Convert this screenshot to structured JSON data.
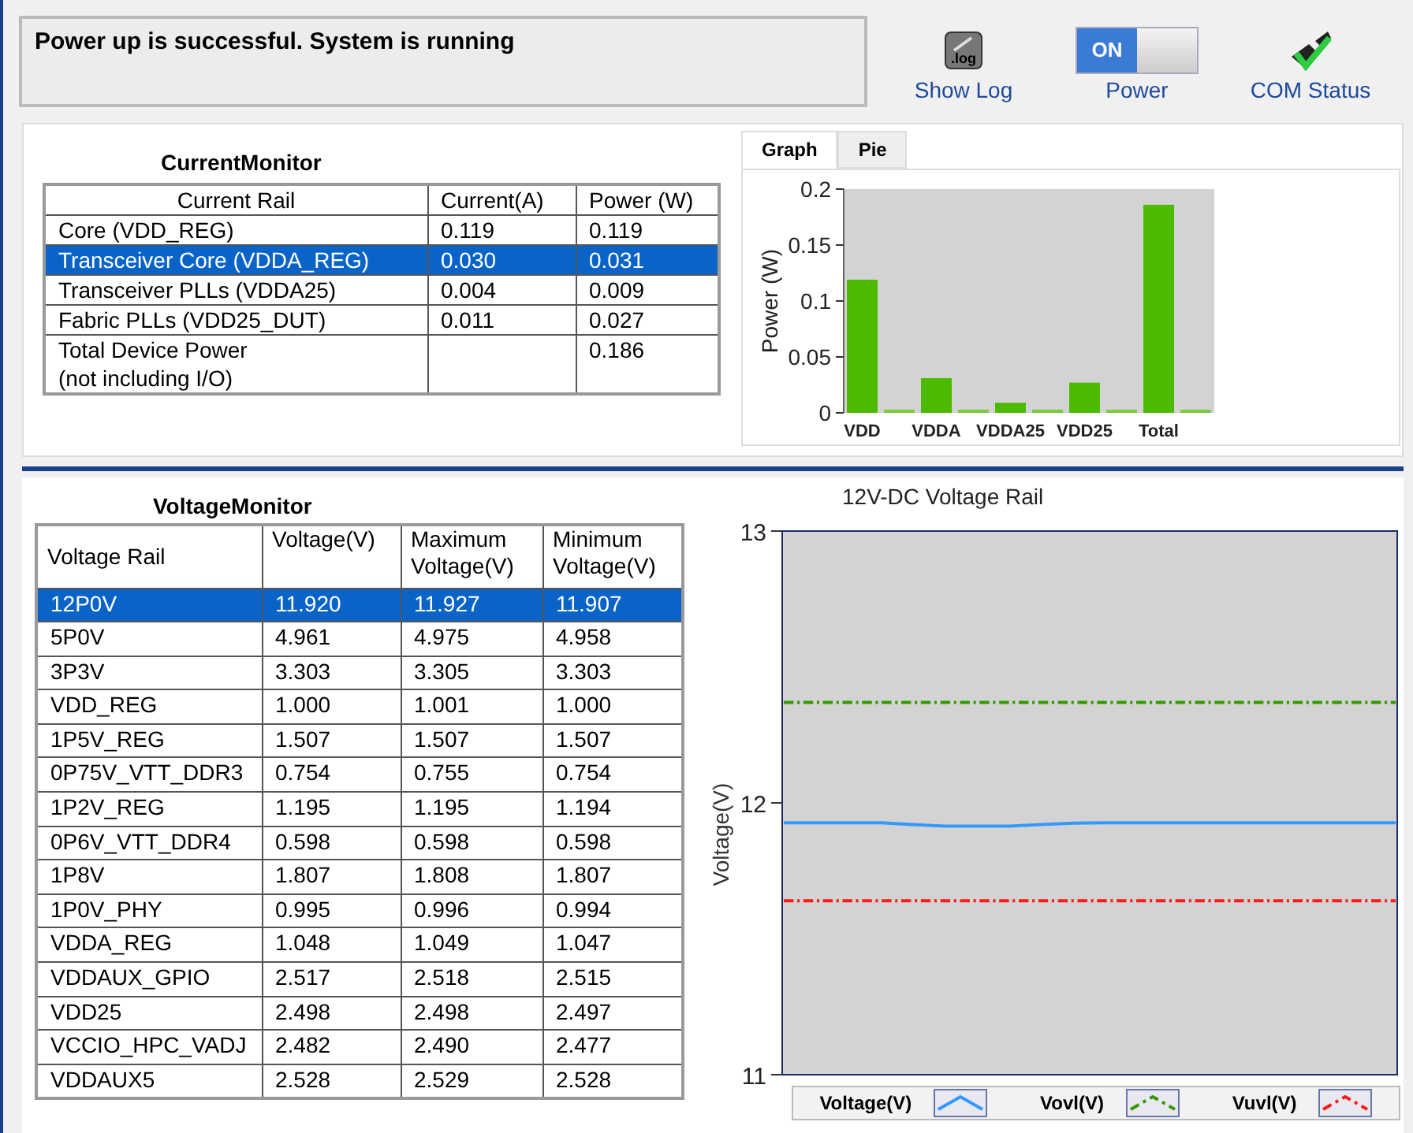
{
  "status_message": "Power up is successful. System is running",
  "toolbar": [
    {
      "kind": "log",
      "label": "Show Log",
      "badge": ".log"
    },
    {
      "kind": "switch",
      "label": "Power",
      "text": "ON",
      "on": true
    },
    {
      "kind": "com",
      "label": "COM Status"
    }
  ],
  "current_monitor": {
    "title": "CurrentMonitor",
    "columns": [
      "Current Rail",
      "Current(A)",
      "Power (W)"
    ],
    "rows": [
      {
        "cells": [
          "Core (VDD_REG)",
          "0.119",
          "0.119"
        ],
        "selected": false
      },
      {
        "cells": [
          "Transceiver Core (VDDA_REG)",
          "0.030",
          "0.031"
        ],
        "selected": true
      },
      {
        "cells": [
          "Transceiver PLLs (VDDA25)",
          "0.004",
          "0.009"
        ],
        "selected": false
      },
      {
        "cells": [
          "Fabric PLLs (VDD25_DUT)",
          "0.011",
          "0.027"
        ],
        "selected": false
      },
      {
        "cells": [
          "Total Device Power\n(not including I/O)",
          "",
          "0.186"
        ],
        "selected": false
      }
    ]
  },
  "tabs": [
    {
      "label": "Graph",
      "selected": true
    },
    {
      "label": "Pie",
      "selected": false
    }
  ],
  "power_chart": {
    "chart_data": {
      "type": "bar",
      "ylabel": "Power (W)",
      "categories": [
        "VDD",
        "VDDA",
        "VDDA25",
        "VDD25",
        "Total"
      ],
      "ylim": [
        0,
        0.2
      ],
      "yticks": [
        0,
        0.05,
        0.1,
        0.15,
        0.2
      ],
      "series": [
        {
          "color": "#4cbb00",
          "values": [
            0.119,
            0.031,
            0.009,
            0.027,
            0.186
          ]
        },
        {
          "color": "#7acc3a",
          "values": [
            0,
            0,
            0,
            0,
            0
          ]
        }
      ]
    }
  },
  "voltage_monitor": {
    "title": "VoltageMonitor",
    "columns": [
      "Voltage Rail",
      "Voltage(V)",
      "Maximum\nVoltage(V)",
      "Minimum\nVoltage(V)"
    ],
    "rows": [
      {
        "cells": [
          "12P0V",
          "11.920",
          "11.927",
          "11.907"
        ],
        "selected": true
      },
      {
        "cells": [
          "5P0V",
          "4.961",
          "4.975",
          "4.958"
        ],
        "selected": false
      },
      {
        "cells": [
          "3P3V",
          "3.303",
          "3.305",
          "3.303"
        ],
        "selected": false
      },
      {
        "cells": [
          "VDD_REG",
          "1.000",
          "1.001",
          "1.000"
        ],
        "selected": false
      },
      {
        "cells": [
          "1P5V_REG",
          "1.507",
          "1.507",
          "1.507"
        ],
        "selected": false
      },
      {
        "cells": [
          "0P75V_VTT_DDR3",
          "0.754",
          "0.755",
          "0.754"
        ],
        "selected": false
      },
      {
        "cells": [
          "1P2V_REG",
          "1.195",
          "1.195",
          "1.194"
        ],
        "selected": false
      },
      {
        "cells": [
          "0P6V_VTT_DDR4",
          "0.598",
          "0.598",
          "0.598"
        ],
        "selected": false
      },
      {
        "cells": [
          "1P8V",
          "1.807",
          "1.808",
          "1.807"
        ],
        "selected": false
      },
      {
        "cells": [
          "1P0V_PHY",
          "0.995",
          "0.996",
          "0.994"
        ],
        "selected": false
      },
      {
        "cells": [
          "VDDA_REG",
          "1.048",
          "1.049",
          "1.047"
        ],
        "selected": false
      },
      {
        "cells": [
          "VDDAUX_GPIO",
          "2.517",
          "2.518",
          "2.515"
        ],
        "selected": false
      },
      {
        "cells": [
          "VDD25",
          "2.498",
          "2.498",
          "2.497"
        ],
        "selected": false
      },
      {
        "cells": [
          "VCCIO_HPC_VADJ",
          "2.482",
          "2.490",
          "2.477"
        ],
        "selected": false
      },
      {
        "cells": [
          "VDDAUX5",
          "2.528",
          "2.529",
          "2.528"
        ],
        "selected": false
      }
    ]
  },
  "rail_chart": {
    "chart_data": {
      "type": "line",
      "title": "12V-DC Voltage Rail",
      "ylabel": "Voltage(V)",
      "ylim": [
        11,
        13
      ],
      "yticks": [
        11,
        12,
        13
      ],
      "legend": "bottom",
      "series": [
        {
          "name": "Voltage(V)",
          "color": "#3399ff",
          "line_style": "solid",
          "values": [
            11.927,
            11.927,
            11.927,
            11.927,
            11.92,
            11.915,
            11.915,
            11.915,
            11.92,
            11.925,
            11.927,
            11.927,
            11.927,
            11.927,
            11.927,
            11.927,
            11.927,
            11.927,
            11.927,
            11.927
          ]
        },
        {
          "name": "Vovl(V)",
          "color": "#339900",
          "line_style": "dash-dot",
          "values": [
            12.37,
            12.37,
            12.37,
            12.37,
            12.37,
            12.37,
            12.37,
            12.37,
            12.37,
            12.37,
            12.37,
            12.37,
            12.37,
            12.37,
            12.37,
            12.37,
            12.37,
            12.37,
            12.37,
            12.37
          ]
        },
        {
          "name": "Vuvl(V)",
          "color": "#ff1a1a",
          "line_style": "dash-dot",
          "values": [
            11.64,
            11.64,
            11.64,
            11.64,
            11.64,
            11.64,
            11.64,
            11.64,
            11.64,
            11.64,
            11.64,
            11.64,
            11.64,
            11.64,
            11.64,
            11.64,
            11.64,
            11.64,
            11.64,
            11.64
          ]
        }
      ]
    }
  }
}
